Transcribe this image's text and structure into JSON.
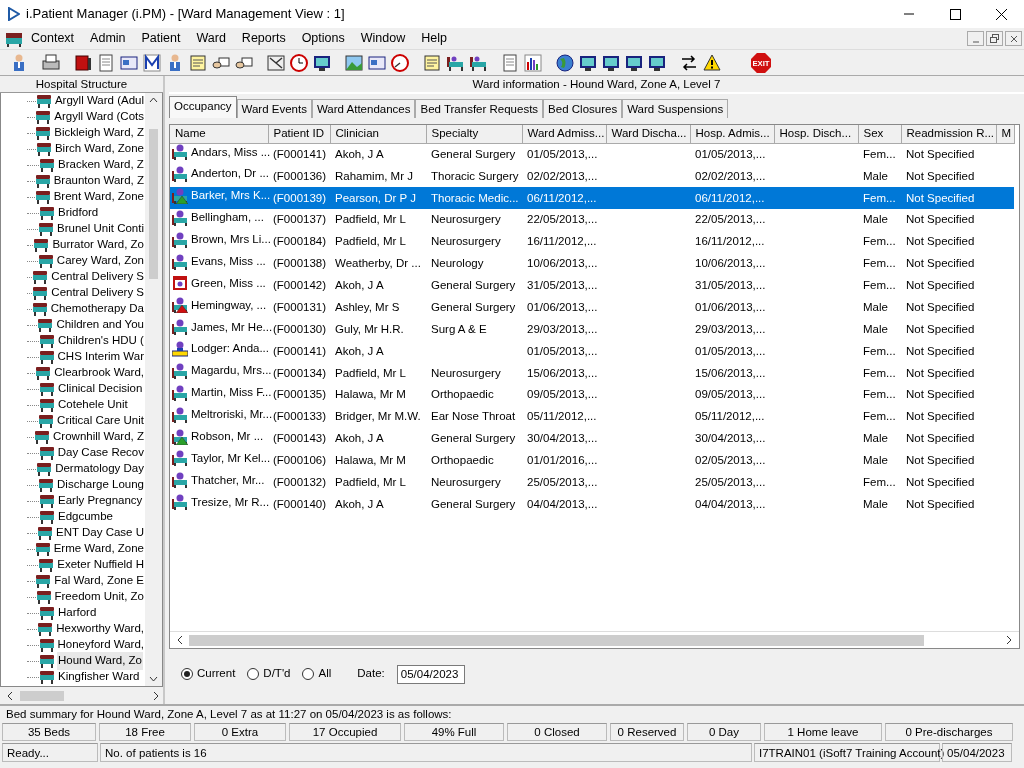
{
  "window": {
    "title": "i.Patient Manager (i.PM) - [Ward Management View : 1]"
  },
  "menu": [
    "Context",
    "Admin",
    "Patient",
    "Ward",
    "Reports",
    "Options",
    "Window",
    "Help"
  ],
  "toolbar": {
    "exit_label": "EXIT"
  },
  "sidebar": {
    "title": "Hospital Structure",
    "items": [
      {
        "label": "Argyll Ward (Adul",
        "selected": false
      },
      {
        "label": "Argyll Ward (Cots",
        "selected": false
      },
      {
        "label": "Bickleigh Ward, Z",
        "selected": false
      },
      {
        "label": "Birch Ward, Zone",
        "selected": false
      },
      {
        "label": "Bracken Ward, Z",
        "selected": false
      },
      {
        "label": "Braunton Ward, Z",
        "selected": false
      },
      {
        "label": "Brent Ward, Zone",
        "selected": false
      },
      {
        "label": "Bridford",
        "selected": false
      },
      {
        "label": "Brunel Unit Conti",
        "selected": false
      },
      {
        "label": "Burrator Ward, Zo",
        "selected": false
      },
      {
        "label": "Carey Ward, Zon",
        "selected": false
      },
      {
        "label": "Central Delivery S",
        "selected": false
      },
      {
        "label": "Central Delivery S",
        "selected": false
      },
      {
        "label": "Chemotherapy Da",
        "selected": false
      },
      {
        "label": "Children and You",
        "selected": false
      },
      {
        "label": "Children's HDU (",
        "selected": false
      },
      {
        "label": "CHS Interim War",
        "selected": false
      },
      {
        "label": "Clearbrook Ward,",
        "selected": false
      },
      {
        "label": "Clinical Decision",
        "selected": false
      },
      {
        "label": "Cotehele Unit",
        "selected": false
      },
      {
        "label": "Critical Care Unit",
        "selected": false
      },
      {
        "label": "Crownhill Ward, Z",
        "selected": false
      },
      {
        "label": "Day Case Recov",
        "selected": false
      },
      {
        "label": "Dermatology Day",
        "selected": false
      },
      {
        "label": "Discharge Loung",
        "selected": false
      },
      {
        "label": "Early Pregnancy",
        "selected": false
      },
      {
        "label": "Edgcumbe",
        "selected": false
      },
      {
        "label": "ENT Day Case U",
        "selected": false
      },
      {
        "label": "Erme Ward, Zone",
        "selected": false
      },
      {
        "label": "Exeter Nuffield H",
        "selected": false
      },
      {
        "label": "Fal Ward, Zone E",
        "selected": false
      },
      {
        "label": "Freedom Unit, Zo",
        "selected": false
      },
      {
        "label": "Harford",
        "selected": false
      },
      {
        "label": "Hexworthy Ward,",
        "selected": false
      },
      {
        "label": "Honeyford Ward,",
        "selected": false
      },
      {
        "label": "Hound Ward, Zo",
        "selected": true
      },
      {
        "label": "Kingfisher Ward",
        "selected": false
      }
    ]
  },
  "ward_info": "Ward information - Hound Ward, Zone A, Level 7",
  "tabs": [
    {
      "label": "Occupancy",
      "selected": true
    },
    {
      "label": "Ward Events",
      "selected": false
    },
    {
      "label": "Ward Attendances",
      "selected": false
    },
    {
      "label": "Bed Transfer Requests",
      "selected": false
    },
    {
      "label": "Bed Closures",
      "selected": false
    },
    {
      "label": "Ward Suspensions",
      "selected": false
    }
  ],
  "table": {
    "columns": [
      "Name",
      "Patient ID",
      "Clinician",
      "Specialty",
      "Ward Admiss...",
      "Ward Discha...",
      "Hosp. Admis...",
      "Hosp. Disch...",
      "Sex",
      "Readmission R...",
      "M"
    ],
    "rows": [
      {
        "kind": "patient",
        "selected": false,
        "cells": [
          "Andars, Miss ...",
          "(F000141)",
          "Akoh, J A",
          "General Surgery",
          "01/05/2013,...",
          "",
          "01/05/2013,...",
          "",
          "Fem...",
          "Not Specified"
        ]
      },
      {
        "kind": "patient",
        "selected": false,
        "cells": [
          "Anderton, Dr ...",
          "(F000136)",
          "Rahamim, Mr J",
          "Thoracic Surgery",
          "02/02/2013,...",
          "",
          "02/02/2013,...",
          "",
          "Male",
          "Not Specified"
        ]
      },
      {
        "kind": "green-alert",
        "selected": true,
        "cells": [
          "Barker, Mrs K...",
          "(F000139)",
          "Pearson, Dr P J",
          "Thoracic Medic...",
          "06/11/2012,...",
          "",
          "06/11/2012,...",
          "",
          "Fem...",
          "Not Specified"
        ]
      },
      {
        "kind": "patient",
        "selected": false,
        "cells": [
          "Bellingham, ...",
          "(F000137)",
          "Padfield, Mr L",
          "Neurosurgery",
          "22/05/2013,...",
          "",
          "22/05/2013,...",
          "",
          "Male",
          "Not Specified"
        ]
      },
      {
        "kind": "patient",
        "selected": false,
        "cells": [
          "Brown, Mrs Li...",
          "(F000184)",
          "Padfield, Mr L",
          "Neurosurgery",
          "16/11/2012,...",
          "",
          "16/11/2012,...",
          "",
          "Fem...",
          "Not Specified"
        ]
      },
      {
        "kind": "patient",
        "selected": false,
        "cells": [
          "Evans, Miss ...",
          "(F000138)",
          "Weatherby, Dr ...",
          "Neurology",
          "10/06/2013,...",
          "",
          "10/06/2013,...",
          "",
          "Fem...",
          "Not Specified"
        ]
      },
      {
        "kind": "box",
        "selected": false,
        "cells": [
          "Green, Miss ...",
          "(F000142)",
          "Akoh, J A",
          "General Surgery",
          "31/05/2013,...",
          "",
          "31/05/2013,...",
          "",
          "Fem...",
          "Not Specified"
        ]
      },
      {
        "kind": "red-alert",
        "selected": false,
        "cells": [
          "Hemingway, ...",
          "(F000131)",
          "Ashley, Mr S",
          "General Surgery",
          "01/06/2013,...",
          "",
          "01/06/2013,...",
          "",
          "Male",
          "Not Specified"
        ]
      },
      {
        "kind": "patient",
        "selected": false,
        "cells": [
          "James, Mr He...",
          "(F000130)",
          "Guly, Mr H.R.",
          "Surg A & E",
          "29/03/2013,...",
          "",
          "29/03/2013,...",
          "",
          "Male",
          "Not Specified"
        ]
      },
      {
        "kind": "lodger",
        "selected": false,
        "cells": [
          "Lodger: Anda...",
          "(F000141)",
          "Akoh, J A",
          "",
          "01/05/2013,...",
          "",
          "01/05/2013,...",
          "",
          "Fem...",
          "Not Specified"
        ]
      },
      {
        "kind": "patient",
        "selected": false,
        "cells": [
          "Magardu, Mrs...",
          "(F000134)",
          "Padfield, Mr L",
          "Neurosurgery",
          "15/06/2013,...",
          "",
          "15/06/2013,...",
          "",
          "Fem...",
          "Not Specified"
        ]
      },
      {
        "kind": "patient",
        "selected": false,
        "cells": [
          "Martin, Miss F...",
          "(F000135)",
          "Halawa, Mr M",
          "Orthopaedic",
          "09/05/2013,...",
          "",
          "09/05/2013,...",
          "",
          "Fem...",
          "Not Specified"
        ]
      },
      {
        "kind": "patient",
        "selected": false,
        "cells": [
          "Meltroriski, Mr...",
          "(F000133)",
          "Bridger, Mr M.W.",
          "Ear Nose Throat",
          "05/11/2012,...",
          "",
          "05/11/2012,...",
          "",
          "Fem...",
          "Not Specified"
        ]
      },
      {
        "kind": "green-alert",
        "selected": false,
        "cells": [
          "Robson, Mr ...",
          "(F000143)",
          "Akoh, J A",
          "General Surgery",
          "30/04/2013,...",
          "",
          "30/04/2013,...",
          "",
          "Male",
          "Not Specified"
        ]
      },
      {
        "kind": "patient",
        "selected": false,
        "cells": [
          "Taylor, Mr Kel...",
          "(F000106)",
          "Halawa, Mr M",
          "Orthopaedic",
          "01/01/2016,...",
          "",
          "02/05/2013,...",
          "",
          "Male",
          "Not Specified"
        ]
      },
      {
        "kind": "patient",
        "selected": false,
        "cells": [
          "Thatcher, Mr...",
          "(F000132)",
          "Padfield, Mr L",
          "Neurosurgery",
          "25/05/2013,...",
          "",
          "25/05/2013,...",
          "",
          "Fem...",
          "Not Specified"
        ]
      },
      {
        "kind": "patient",
        "selected": false,
        "cells": [
          "Tresize, Mr R...",
          "(F000140)",
          "Akoh, J A",
          "General Surgery",
          "04/04/2013,...",
          "",
          "04/04/2013,...",
          "",
          "Male",
          "Not Specified"
        ]
      }
    ]
  },
  "filter": {
    "options": [
      {
        "label": "Current",
        "selected": true
      },
      {
        "label": "D/T'd",
        "selected": false
      },
      {
        "label": "All",
        "selected": false
      }
    ],
    "date_label": "Date:",
    "date": "05/04/2023"
  },
  "bed_summary": "Bed summary for Hound Ward, Zone A, Level 7 as at 11:27 on 05/04/2023 is as follows:",
  "stats": [
    "35 Beds",
    "18 Free",
    "0 Extra",
    "17 Occupied",
    "49% Full",
    "0 Closed",
    "0 Reserved",
    "0 Day",
    "1 Home leave",
    "0 Pre-discharges"
  ],
  "status_bar": [
    "Ready...",
    "No. of patients is 16",
    "I7TRAIN01 (iSoft7 Training Account)",
    "05/04/2023"
  ]
}
